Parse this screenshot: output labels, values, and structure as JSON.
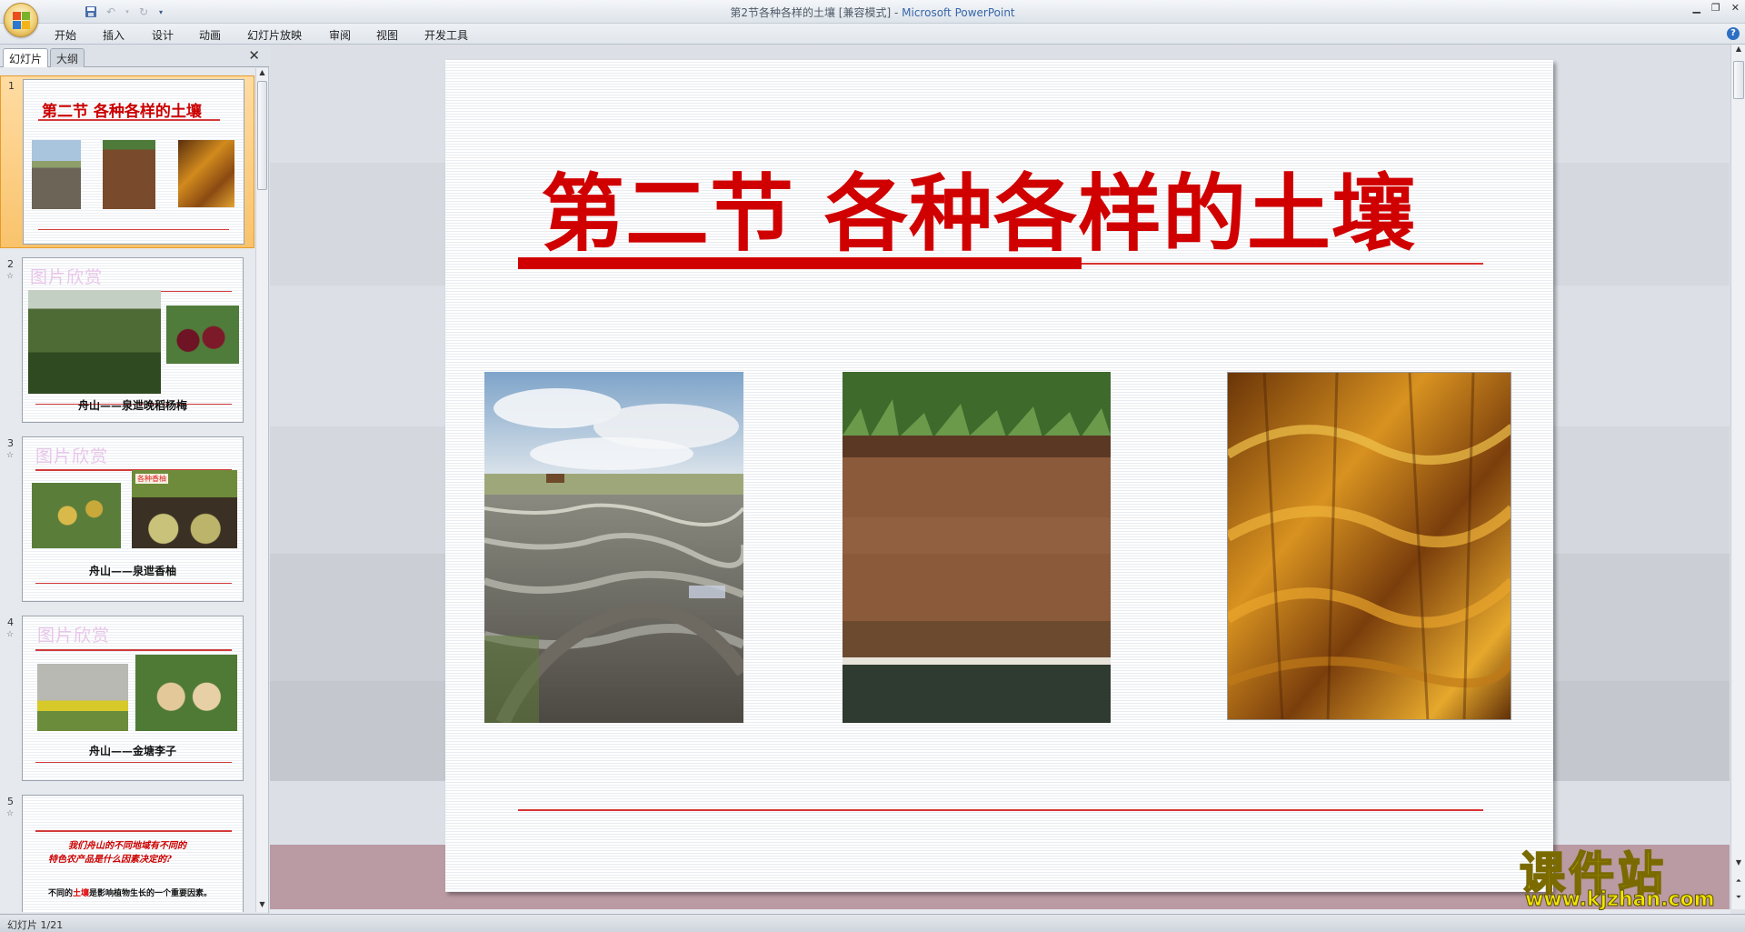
{
  "window": {
    "title_doc": "第2节各种各样的土壤 [兼容模式] - ",
    "title_app": "Microsoft PowerPoint"
  },
  "ribbon": {
    "tabs": [
      "开始",
      "插入",
      "设计",
      "动画",
      "幻灯片放映",
      "审阅",
      "视图",
      "开发工具"
    ]
  },
  "left_pane": {
    "tabs": [
      "幻灯片",
      "大纲"
    ],
    "close_label": "✕",
    "slides": [
      {
        "number": "1",
        "title": "第二节 各种各样的土壤"
      },
      {
        "number": "2",
        "watermark": "图片欣赏",
        "caption": "舟山——泉迣晚稻杨梅"
      },
      {
        "number": "3",
        "watermark": "图片欣赏",
        "caption": "舟山——泉迣香柚",
        "sign_text": "各种香柚"
      },
      {
        "number": "4",
        "watermark": "图片欣赏",
        "caption": "舟山——金塘李子"
      },
      {
        "number": "5",
        "red_text_1": "我们舟山的不同地域有不同的",
        "red_text_2": "特色农产品是什么因素决定的?",
        "black_prefix": "不同的",
        "black_em": "土壤",
        "black_suffix": "是影响植物生长的一个重要因素。"
      }
    ]
  },
  "slide": {
    "title": "第二节  各种各样的土壤",
    "photos": [
      "ploughed-field-photo",
      "soil-profile-photo",
      "eroded-soil-photo"
    ]
  },
  "status": {
    "slide_counter": "幻灯片 1/21"
  },
  "watermark": {
    "cn": "课件站",
    "url": "www.kjzhan.com"
  },
  "colors": {
    "title_red": "#d00000",
    "selected_thumb": "#f9c36b"
  }
}
